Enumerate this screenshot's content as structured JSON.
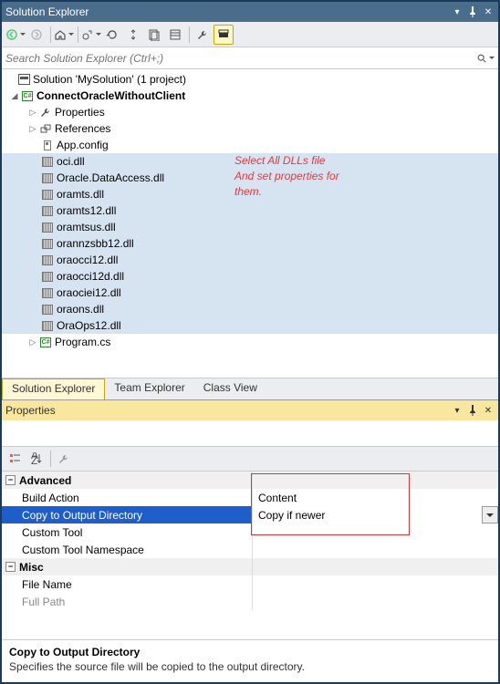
{
  "solutionExplorer": {
    "title": "Solution Explorer",
    "searchPlaceholder": "Search Solution Explorer (Ctrl+;)",
    "solution": "Solution 'MySolution' (1 project)",
    "project": "ConnectOracleWithoutClient",
    "nodes": {
      "properties": "Properties",
      "references": "References",
      "appConfig": "App.config",
      "files": [
        "oci.dll",
        "Oracle.DataAccess.dll",
        "oramts.dll",
        "oramts12.dll",
        "oramtsus.dll",
        "orannzsbb12.dll",
        "oraocci12.dll",
        "oraocci12d.dll",
        "oraociei12.dll",
        "oraons.dll",
        "OraOps12.dll"
      ],
      "program": "Program.cs"
    },
    "tabs": [
      "Solution Explorer",
      "Team Explorer",
      "Class View"
    ]
  },
  "annotation": {
    "line1": "Select All DLLs file",
    "line2": "And set properties for",
    "line3": "them."
  },
  "properties": {
    "title": "Properties",
    "categories": {
      "advanced": "Advanced",
      "misc": "Misc"
    },
    "rows": {
      "buildAction": {
        "label": "Build Action",
        "value": "Content"
      },
      "copyToOutput": {
        "label": "Copy to Output Directory",
        "value": "Copy if newer"
      },
      "customTool": {
        "label": "Custom Tool",
        "value": ""
      },
      "customToolNs": {
        "label": "Custom Tool Namespace",
        "value": ""
      },
      "fileName": {
        "label": "File Name",
        "value": ""
      },
      "fullPath": {
        "label": "Full Path",
        "value": ""
      }
    },
    "description": {
      "title": "Copy to Output Directory",
      "text": "Specifies the source file will be copied to the output directory."
    }
  }
}
